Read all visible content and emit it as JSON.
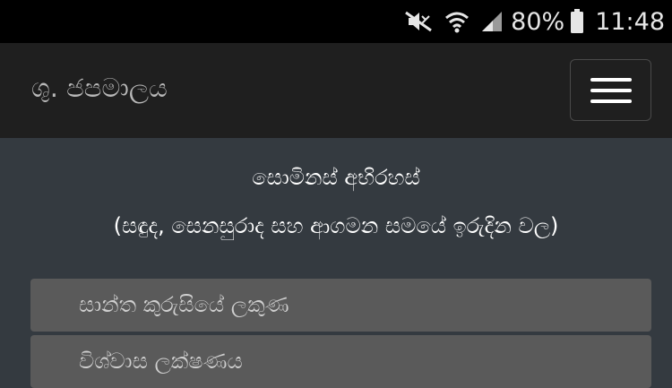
{
  "status_bar": {
    "battery": "80%",
    "time": "11:48"
  },
  "header": {
    "brand": "ශු. ජපමාලය"
  },
  "main": {
    "title": "සොමිනස් අභිරහස්",
    "subtitle": "(සඳුද, සෙනසුරාද සහ ආගමන සමයේ ඉරුදින වල)",
    "items": [
      {
        "label": "සාන්ත කුරුසියේ ලකුණ"
      },
      {
        "label": "විශ්වාස ලක්ෂණය"
      }
    ]
  },
  "colors": {
    "status_bar_bg": "#000000",
    "navbar_bg": "#1f1f1f",
    "page_bg": "#343a40",
    "list_item_bg": "#5a5a5a"
  },
  "icons": [
    "mute-icon",
    "wifi-icon",
    "signal-icon",
    "battery-icon",
    "menu-icon"
  ]
}
